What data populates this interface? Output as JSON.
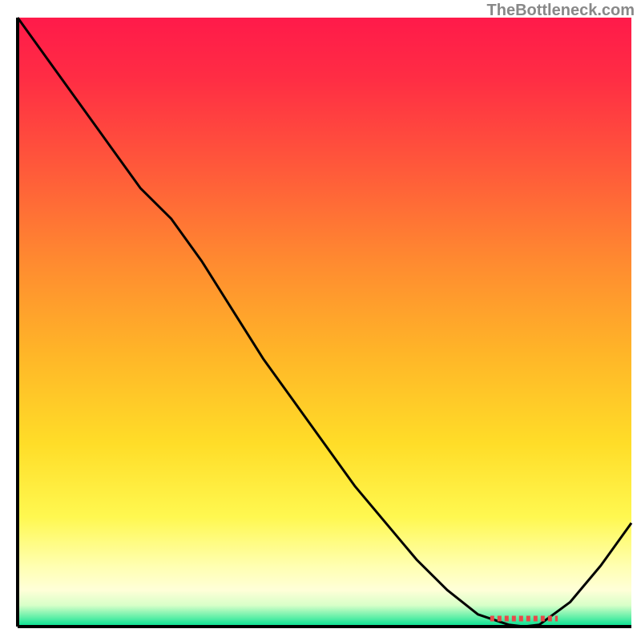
{
  "watermark": "TheBottleneck.com",
  "chart_data": {
    "type": "line",
    "x": [
      0.0,
      0.05,
      0.1,
      0.15,
      0.2,
      0.25,
      0.3,
      0.35,
      0.4,
      0.45,
      0.5,
      0.55,
      0.6,
      0.65,
      0.7,
      0.75,
      0.8,
      0.825,
      0.85,
      0.9,
      0.95,
      1.0
    ],
    "values": [
      1.0,
      0.93,
      0.86,
      0.79,
      0.72,
      0.67,
      0.6,
      0.52,
      0.44,
      0.37,
      0.3,
      0.23,
      0.17,
      0.11,
      0.06,
      0.02,
      0.003,
      0.0,
      0.003,
      0.04,
      0.1,
      0.17
    ],
    "title": "",
    "xlabel": "",
    "ylabel": "",
    "xlim": [
      0,
      1
    ],
    "ylim": [
      0,
      1
    ],
    "optimal_range_x": [
      0.77,
      0.88
    ],
    "gradient_stops": [
      {
        "offset": 0.0,
        "color": "#ff1a4a"
      },
      {
        "offset": 0.1,
        "color": "#ff2d44"
      },
      {
        "offset": 0.25,
        "color": "#ff5a3a"
      },
      {
        "offset": 0.4,
        "color": "#ff8a30"
      },
      {
        "offset": 0.55,
        "color": "#ffb528"
      },
      {
        "offset": 0.7,
        "color": "#ffdd28"
      },
      {
        "offset": 0.82,
        "color": "#fff850"
      },
      {
        "offset": 0.9,
        "color": "#ffffb0"
      },
      {
        "offset": 0.94,
        "color": "#ffffd8"
      },
      {
        "offset": 0.965,
        "color": "#d8ffc8"
      },
      {
        "offset": 0.985,
        "color": "#60efa8"
      },
      {
        "offset": 1.0,
        "color": "#00e090"
      }
    ]
  }
}
